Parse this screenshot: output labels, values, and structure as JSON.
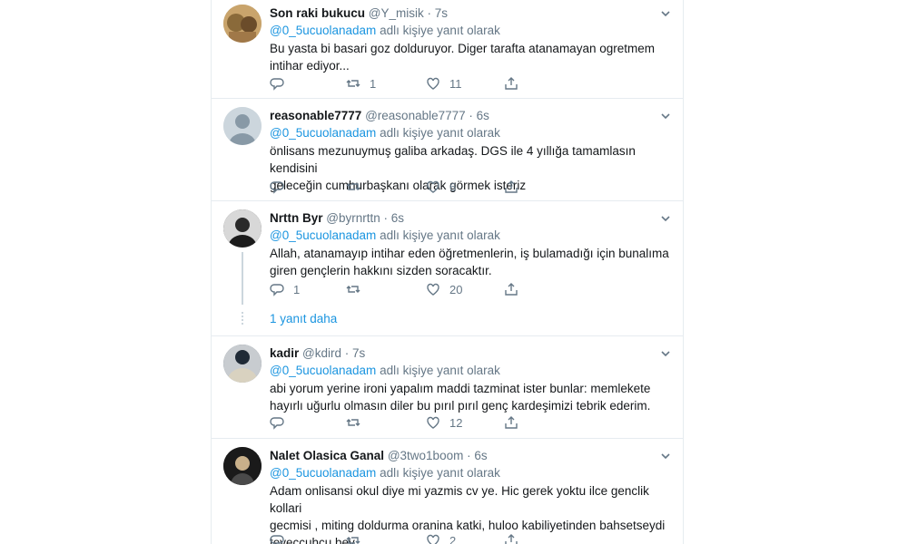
{
  "replying_suffix": "adlı kişiye yanıt olarak",
  "more_replies": "1 yanıt daha",
  "tweets": [
    {
      "name": "Son raki bukucu",
      "handle": "@Y_misik",
      "time": "7s",
      "mention": "@0_5ucuolanadam",
      "lines": [
        "Bu yasta bi basari goz dolduruyor. Diger tarafta atanamayan ogretmem",
        "intihar ediyor..."
      ],
      "replies": "",
      "retweets": "1",
      "likes": "11",
      "avatar_color": "#b49560"
    },
    {
      "name": "reasonable7777",
      "handle": "@reasonable7777",
      "time": "6s",
      "mention": "@0_5ucuolanadam",
      "lines": [
        "önlisans mezunuymuş galiba arkadaş. DGS ile 4 yıllığa tamamlasın kendisini",
        "geleceğin cumhurbaşkanı olarak görmek isteriz"
      ],
      "replies": "",
      "retweets": "",
      "likes": "6",
      "avatar_color": "#ccd6dd"
    },
    {
      "name": "Nrttn Byr",
      "handle": "@byrnrttn",
      "time": "6s",
      "mention": "@0_5ucuolanadam",
      "lines": [
        "Allah, atanamayıp intihar eden öğretmenlerin, iş bulamadığı için bunalıma",
        "giren gençlerin hakkını sizden soracaktır."
      ],
      "replies": "1",
      "retweets": "",
      "likes": "20",
      "avatar_color": "#3a3a3a"
    },
    {
      "name": "kadir",
      "handle": "@kdird",
      "time": "7s",
      "mention": "@0_5ucuolanadam",
      "lines": [
        "abi yorum yerine ironi yapalım maddi tazminat ister bunlar: memlekete",
        "hayırlı uğurlu olmasın diler bu pırıl pırıl genç kardeşimizi tebrik ederim."
      ],
      "replies": "",
      "retweets": "",
      "likes": "12",
      "avatar_color": "#556270"
    },
    {
      "name": "Nalet Olasica Ganal",
      "handle": "@3two1boom",
      "time": "6s",
      "mention": "@0_5ucuolanadam",
      "lines": [
        "Adam onlisansi okul diye mi yazmis cv ye. Hic gerek yoktu ilce genclik kollari",
        "gecmisi , miting doldurma oranina katki, huloo kabiliyetinden bahsetseydi",
        "teveccuhcu bey."
      ],
      "replies": "",
      "retweets": "",
      "likes": "2",
      "avatar_color": "#2a2a2a"
    }
  ]
}
